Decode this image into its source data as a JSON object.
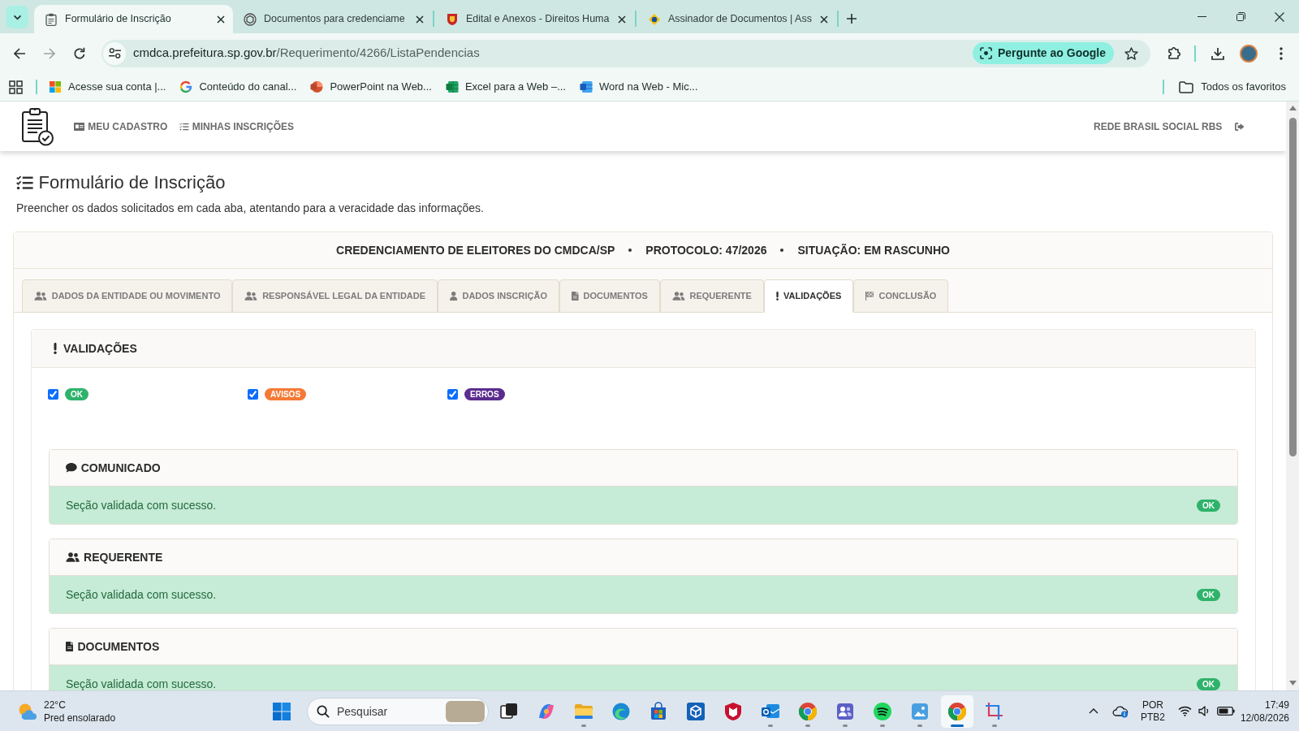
{
  "browser": {
    "tabs": [
      {
        "title": "Formulário de Inscrição",
        "selected": true
      },
      {
        "title": "Documentos para credenciame",
        "selected": false
      },
      {
        "title": "Edital e Anexos - Direitos Huma",
        "selected": false
      },
      {
        "title": "Assinador de Documentos | Ass",
        "selected": false
      }
    ],
    "address": {
      "host": "cmdca.prefeitura.sp.gov.br",
      "path": "/Requerimento/4266/ListaPendencias"
    },
    "ask_button": "Pergunte ao Google",
    "bookmarks": [
      "Acesse sua conta |...",
      "Conteúdo do canal...",
      "PowerPoint na Web...",
      "Excel para a Web –...",
      "Word na Web - Mic..."
    ],
    "all_bookmarks": "Todos os favoritos"
  },
  "site_header": {
    "nav": [
      "MEU CADASTRO",
      "MINHAS INSCRIÇÕES"
    ],
    "user": "REDE BRASIL SOCIAL RBS"
  },
  "page": {
    "title": "Formulário de Inscrição",
    "subtitle": "Preencher os dados solicitados em cada aba, atentando para a veracidade das informações."
  },
  "form": {
    "summary": [
      "CREDENCIAMENTO DE ELEITORES DO CMDCA/SP",
      "PROTOCOLO: 47/2026",
      "SITUAÇÃO: EM RASCUNHO"
    ],
    "tabs": [
      {
        "label": "DADOS DA ENTIDADE OU MOVIMENTO",
        "selected": false
      },
      {
        "label": "RESPONSÁVEL LEGAL DA ENTIDADE",
        "selected": false
      },
      {
        "label": "DADOS INSCRIÇÃO",
        "selected": false
      },
      {
        "label": "DOCUMENTOS",
        "selected": false
      },
      {
        "label": "REQUERENTE",
        "selected": false
      },
      {
        "label": "VALIDAÇÕES",
        "selected": true
      },
      {
        "label": "CONCLUSÃO",
        "selected": false
      }
    ],
    "validations": {
      "title": "VALIDAÇÕES",
      "filters": [
        {
          "label": "OK",
          "checked": true,
          "color": "#2eb36a"
        },
        {
          "label": "AVISOS",
          "checked": true,
          "color": "#f47a36"
        },
        {
          "label": "ERROS",
          "checked": true,
          "color": "#5b2c8f"
        }
      ],
      "sections": [
        {
          "title": "COMUNICADO",
          "kind": "success",
          "message": "Seção validada com sucesso.",
          "status": "OK"
        },
        {
          "title": "REQUERENTE",
          "kind": "success",
          "message": "Seção validada com sucesso.",
          "status": "OK"
        },
        {
          "title": "DOCUMENTOS",
          "kind": "success",
          "message": "Seção validada com sucesso.",
          "status": "OK"
        }
      ]
    }
  },
  "taskbar": {
    "weather": {
      "temperature": "22°C",
      "condition": "Pred ensolarado"
    },
    "search_placeholder": "Pesquisar",
    "apps": [
      {
        "running": false,
        "selected": false
      },
      {
        "running": false,
        "selected": false
      },
      {
        "running": true,
        "selected": false
      },
      {
        "running": false,
        "selected": false
      },
      {
        "running": false,
        "selected": false
      },
      {
        "running": false,
        "selected": false
      },
      {
        "running": false,
        "selected": false
      },
      {
        "running": true,
        "selected": false
      },
      {
        "running": true,
        "selected": false
      },
      {
        "running": true,
        "selected": false
      },
      {
        "running": true,
        "selected": false
      },
      {
        "running": true,
        "selected": false
      },
      {
        "running": true,
        "selected": true
      },
      {
        "running": true,
        "selected": false
      }
    ],
    "tray": {
      "language": "POR",
      "layout": "PTB2",
      "time": "17:49",
      "date": "12/08/2026"
    }
  }
}
